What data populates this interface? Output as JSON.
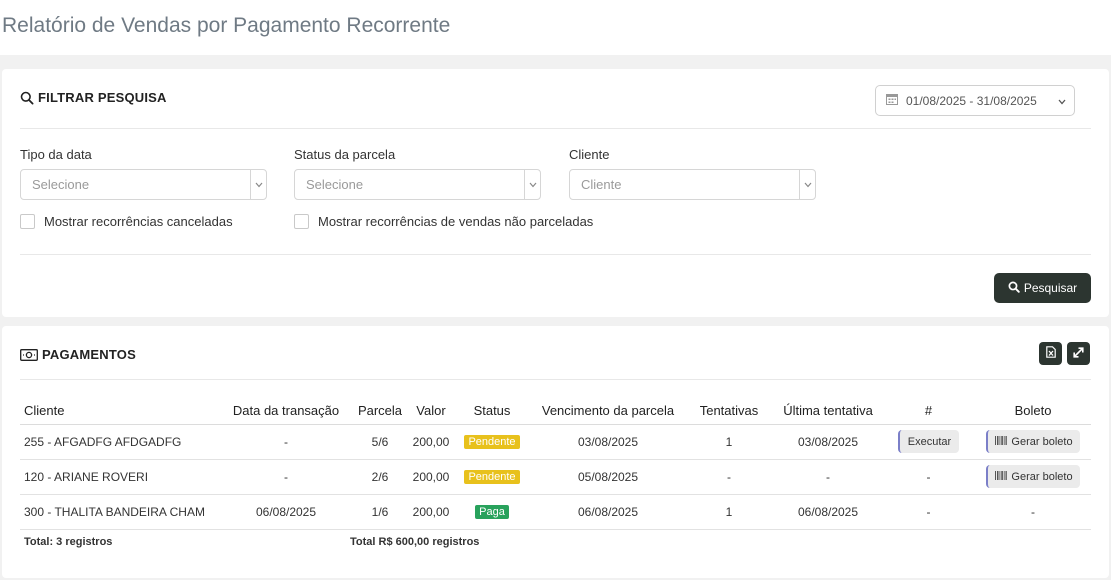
{
  "page": {
    "title": "Relatório de Vendas por Pagamento Recorrente"
  },
  "filter": {
    "title": "FILTRAR PESQUISA",
    "date_range": "01/08/2025 - 31/08/2025",
    "fields": [
      {
        "label": "Tipo da data",
        "placeholder": "Selecione"
      },
      {
        "label": "Status da parcela",
        "placeholder": "Selecione"
      },
      {
        "label": "Cliente",
        "placeholder": "Cliente"
      }
    ],
    "checkboxes": [
      {
        "label": "Mostrar recorrências canceladas",
        "checked": false
      },
      {
        "label": "Mostrar recorrências de vendas não parceladas",
        "checked": false
      }
    ],
    "search_label": "Pesquisar",
    "icons": {
      "search": "search-icon",
      "calendar": "calendar-icon",
      "chevron": "chevron-down-icon"
    }
  },
  "payments": {
    "title": "PAGAMENTOS",
    "icons": {
      "money": "money-icon",
      "excel": "excel-export-icon",
      "expand": "expand-icon"
    },
    "columns": [
      "Cliente",
      "Data da transação",
      "Parcela",
      "Valor",
      "Status",
      "Vencimento da parcela",
      "Tentativas",
      "Última tentativa",
      "#",
      "Boleto"
    ],
    "rows": [
      {
        "cliente": "255 - AFGADFG AFDGADFG",
        "data": "-",
        "parcela": "5/6",
        "valor": "200,00",
        "status": "Pendente",
        "vencimento": "03/08/2025",
        "tentativas": "1",
        "ultima": "03/08/2025",
        "acao": "Executar",
        "boleto": "Gerar boleto"
      },
      {
        "cliente": "120 - ARIANE ROVERI",
        "data": "-",
        "parcela": "2/6",
        "valor": "200,00",
        "status": "Pendente",
        "vencimento": "05/08/2025",
        "tentativas": "-",
        "ultima": "-",
        "acao": "-",
        "boleto": "Gerar boleto"
      },
      {
        "cliente": "300 - THALITA BANDEIRA CHAM",
        "data": "06/08/2025",
        "parcela": "1/6",
        "valor": "200,00",
        "status": "Paga",
        "vencimento": "06/08/2025",
        "tentativas": "1",
        "ultima": "06/08/2025",
        "acao": "-",
        "boleto": "-"
      }
    ],
    "footer": {
      "total_registros": "Total: 3 registros",
      "total_valor": "Total R$ 600,00 registros"
    },
    "colors": {
      "pendente": "#e8c11c",
      "paga": "#28a25c",
      "dark_button": "#2c3530"
    }
  }
}
